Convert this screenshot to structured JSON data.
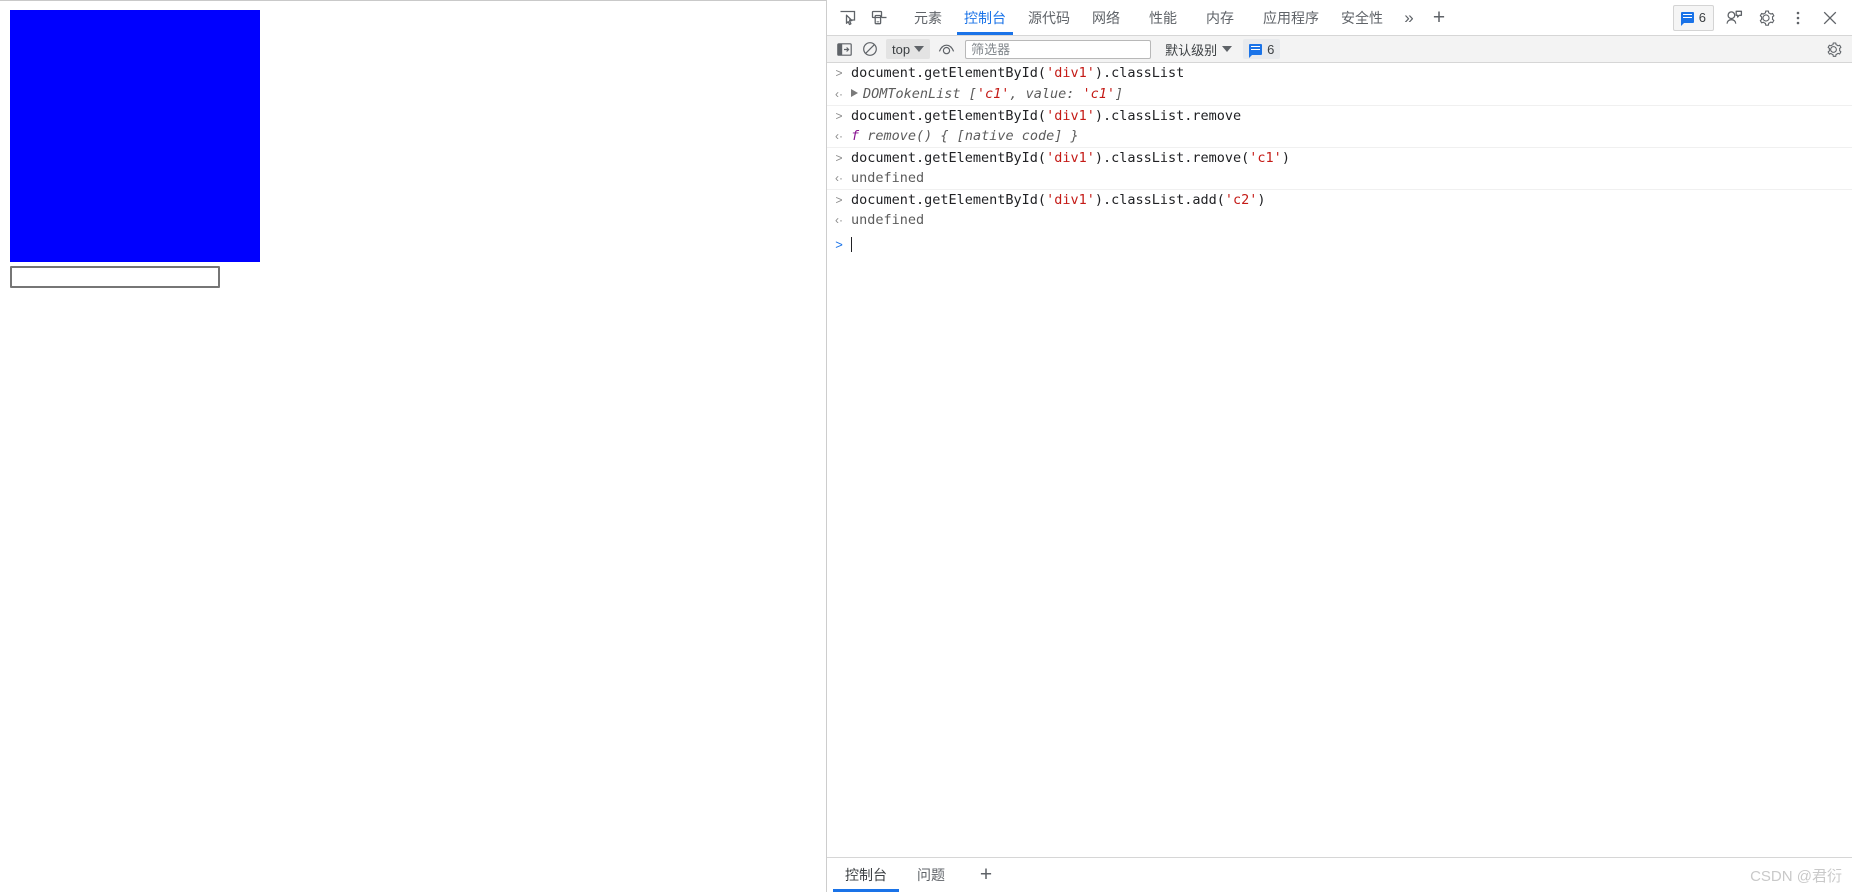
{
  "page": {
    "blue_box": {
      "color": "#0000ff",
      "name": "div1"
    },
    "text_input": {
      "value": "",
      "placeholder": ""
    }
  },
  "devtools": {
    "tabs": [
      {
        "label": "元素",
        "active": false
      },
      {
        "label": "控制台",
        "active": true
      },
      {
        "label": "源代码",
        "active": false
      },
      {
        "label": "网络",
        "active": false
      },
      {
        "label": "性能",
        "active": false
      },
      {
        "label": "内存",
        "active": false
      },
      {
        "label": "应用程序",
        "active": false
      },
      {
        "label": "安全性",
        "active": false
      }
    ],
    "tab_overflow_label": "»",
    "tab_add_label": "+",
    "issues_badge_count": "6",
    "icons": {
      "inspect": "inspect-element-icon",
      "device": "device-toolbar-icon",
      "issues": "issues-message-icon",
      "feedback": "feedback-icon",
      "settings": "gear-icon",
      "more": "more-vertical-icon",
      "close": "close-icon"
    },
    "filterbar": {
      "sidebar_toggle": "console-sidebar-icon",
      "clear_console": "clear-console-icon",
      "context_label": "top",
      "live_expression": "eye-icon",
      "filter_placeholder": "筛选器",
      "filter_value": "",
      "level_label": "默认级别",
      "issues_count": "6",
      "settings": "gear-icon"
    },
    "console": {
      "entries": [
        {
          "kind": "command",
          "gutter": ">",
          "parts": [
            {
              "t": "document.getElementById(",
              "c": "plain"
            },
            {
              "t": "'div1'",
              "c": "string"
            },
            {
              "t": ").classList",
              "c": "plain"
            }
          ]
        },
        {
          "kind": "result",
          "gutter": "‹·",
          "expandable": true,
          "parts": [
            {
              "t": "DOMTokenList ['c1', value: 'c1']",
              "c": "object"
            }
          ],
          "object_name": "DOMTokenList ",
          "object_open": "[",
          "object_v1": "'c1'",
          "object_mid": ", value: ",
          "object_v2": "'c1'",
          "object_close": "]"
        },
        {
          "kind": "command",
          "gutter": ">",
          "parts": [
            {
              "t": "document.getElementById(",
              "c": "plain"
            },
            {
              "t": "'div1'",
              "c": "string"
            },
            {
              "t": ").classList.remove",
              "c": "plain"
            }
          ]
        },
        {
          "kind": "result",
          "gutter": "‹·",
          "fn_marker": "f",
          "fn_text": "remove() { [native code] }"
        },
        {
          "kind": "command",
          "gutter": ">",
          "parts": [
            {
              "t": "document.getElementById(",
              "c": "plain"
            },
            {
              "t": "'div1'",
              "c": "string"
            },
            {
              "t": ").classList.remove(",
              "c": "plain"
            },
            {
              "t": "'c1'",
              "c": "string"
            },
            {
              "t": ")",
              "c": "plain"
            }
          ]
        },
        {
          "kind": "result",
          "gutter": "‹·",
          "plain_text": "undefined"
        },
        {
          "kind": "command",
          "gutter": ">",
          "parts": [
            {
              "t": "document.getElementById(",
              "c": "plain"
            },
            {
              "t": "'div1'",
              "c": "string"
            },
            {
              "t": ").classList.add(",
              "c": "plain"
            },
            {
              "t": "'c2'",
              "c": "string"
            },
            {
              "t": ")",
              "c": "plain"
            }
          ]
        },
        {
          "kind": "result",
          "gutter": "‹·",
          "plain_text": "undefined"
        }
      ],
      "prompt": {
        "caret": ">",
        "value": ""
      }
    },
    "drawer": {
      "tabs": [
        {
          "label": "控制台",
          "active": true
        },
        {
          "label": "问题",
          "active": false
        }
      ],
      "add_label": "+"
    }
  },
  "watermark": {
    "text": "CSDN @君衍"
  },
  "colors": {
    "accent": "#1a73e8",
    "blue_box": "#0000ff",
    "string_token": "#c41a16",
    "toolbar_bg": "#f3f3f3"
  }
}
